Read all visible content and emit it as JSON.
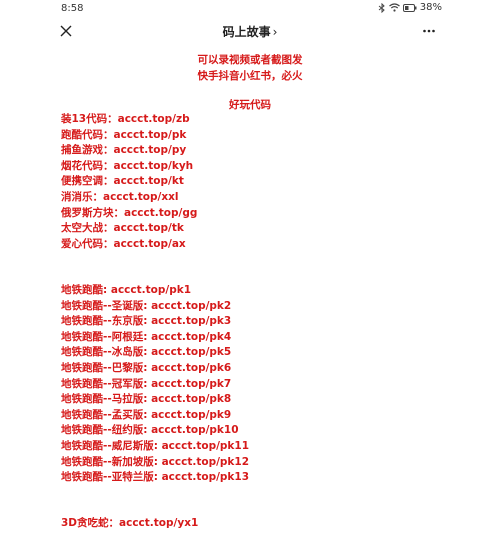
{
  "status": {
    "time": "8:58",
    "battery": "38%"
  },
  "nav": {
    "title": "码上故事",
    "chevron": "›"
  },
  "intro": [
    "可以录视频或者截图发",
    "快手抖音小红书，必火"
  ],
  "section_title": "好玩代码",
  "group1": [
    "装13代码：accct.top/zb",
    "跑酷代码：accct.top/pk",
    "捕鱼游戏：accct.top/py",
    "烟花代码：accct.top/kyh",
    "便携空调：accct.top/kt",
    "消消乐：accct.top/xxl",
    "俄罗斯方块：accct.top/gg",
    "太空大战：accct.top/tk",
    "爱心代码：accct.top/ax"
  ],
  "group2": [
    "地铁跑酷: accct.top/pk1",
    "地铁跑酷--圣诞版: accct.top/pk2",
    "地铁跑酷--东京版: accct.top/pk3",
    "地铁跑酷--阿根廷: accct.top/pk4",
    "地铁跑酷--冰岛版: accct.top/pk5",
    "地铁跑酷--巴黎版: accct.top/pk6",
    "地铁跑酷--冠军版: accct.top/pk7",
    "地铁跑酷--马拉版: accct.top/pk8",
    "地铁跑酷--孟买版: accct.top/pk9",
    "地铁跑酷--纽约版: accct.top/pk10",
    "地铁跑酷--威尼斯版: accct.top/pk11",
    "地铁跑酷--新加坡版: accct.top/pk12",
    "地铁跑酷--亚特兰版: accct.top/pk13"
  ],
  "group3": [
    "3D贪吃蛇：accct.top/yx1"
  ],
  "icons": {
    "close": "close-icon",
    "more": "more-icon",
    "bluetooth": "bluetooth-icon",
    "wifi": "wifi-icon",
    "battery": "battery-icon"
  },
  "colors": {
    "accent": "#d61a1a",
    "text": "#222222"
  }
}
